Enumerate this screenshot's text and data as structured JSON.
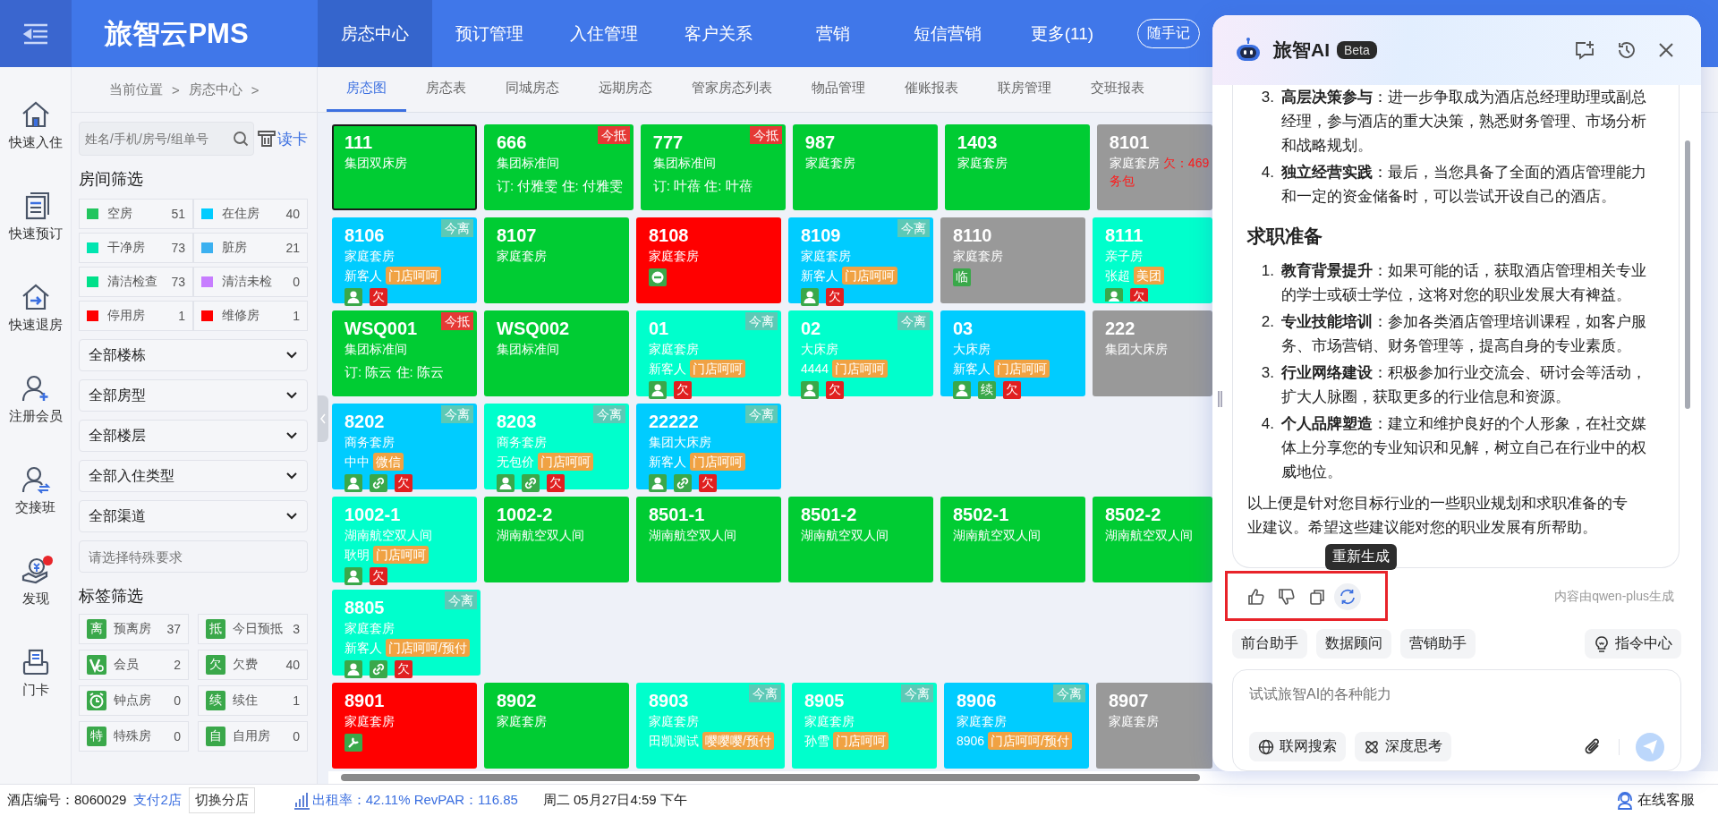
{
  "top_bar": {
    "brand": "旅智云PMS",
    "nav": [
      {
        "label": "房态中心",
        "selected": true
      },
      {
        "label": "预订管理",
        "selected": false
      },
      {
        "label": "入住管理",
        "selected": false
      },
      {
        "label": "客户关系",
        "selected": false
      },
      {
        "label": "营销",
        "selected": false
      },
      {
        "label": "短信营销",
        "selected": false
      },
      {
        "label": "更多(11)",
        "selected": false
      }
    ],
    "notes_button": "随手记"
  },
  "quick_actions": [
    {
      "kind": "home",
      "label": "快速入住",
      "badge": false
    },
    {
      "kind": "doc",
      "label": "快速预订",
      "badge": false
    },
    {
      "kind": "checkout",
      "label": "快速退房",
      "badge": false
    },
    {
      "kind": "user-add",
      "label": "注册会员",
      "badge": false
    },
    {
      "kind": "user-swap",
      "label": "交接班",
      "badge": false
    },
    {
      "kind": "money",
      "label": "发现",
      "badge": true
    },
    {
      "kind": "printer",
      "label": "门卡",
      "badge": false
    }
  ],
  "breadcrumb": {
    "items": [
      "当前位置",
      "房态中心"
    ],
    "separator": ">"
  },
  "search": {
    "placeholder": "姓名/手机/房号/组单号",
    "card_reader": "读卡"
  },
  "room_filter": {
    "title": "房间筛选",
    "items": [
      {
        "label": "空房",
        "count": "51",
        "color": "#22c55e"
      },
      {
        "label": "在住房",
        "count": "40",
        "color": "#00ccff"
      },
      {
        "label": "干净房",
        "count": "73",
        "color": "#00e5b0"
      },
      {
        "label": "脏房",
        "count": "21",
        "color": "#3bb0f0"
      },
      {
        "label": "清洁检查",
        "count": "73",
        "color": "#00e08a"
      },
      {
        "label": "清洁未检",
        "count": "0",
        "color": "#c77dff"
      },
      {
        "label": "停用房",
        "count": "1",
        "color": "#ff0000"
      },
      {
        "label": "维修房",
        "count": "1",
        "color": "#ff0000"
      }
    ]
  },
  "selects": [
    "全部楼栋",
    "全部房型",
    "全部楼层",
    "全部入住类型",
    "全部渠道"
  ],
  "special_request": {
    "placeholder": "请选择特殊要求"
  },
  "tag_filter": {
    "title": "标签筛选",
    "items": [
      {
        "kind": "char",
        "mark": "离",
        "label": "预离房",
        "count": "37"
      },
      {
        "kind": "char",
        "mark": "抵",
        "label": "今日预抵",
        "count": "3"
      },
      {
        "kind": "vip",
        "label": "会员",
        "count": "2"
      },
      {
        "kind": "char",
        "mark": "欠",
        "label": "欠费",
        "count": "40"
      },
      {
        "kind": "clock",
        "label": "钟点房",
        "count": "0"
      },
      {
        "kind": "char",
        "mark": "续",
        "label": "续住",
        "count": "1"
      },
      {
        "kind": "char",
        "mark": "特",
        "label": "特殊房",
        "count": "0"
      },
      {
        "kind": "char",
        "mark": "自",
        "label": "自用房",
        "count": "0"
      }
    ]
  },
  "tabs": [
    {
      "label": "房态图",
      "selected": true
    },
    {
      "label": "房态表",
      "selected": false
    },
    {
      "label": "同城房态",
      "selected": false
    },
    {
      "label": "远期房态",
      "selected": false
    },
    {
      "label": "管家房态列表",
      "selected": false
    },
    {
      "label": "物品管理",
      "selected": false
    },
    {
      "label": "催账报表",
      "selected": false
    },
    {
      "label": "联房管理",
      "selected": false
    },
    {
      "label": "交班报表",
      "selected": false
    }
  ],
  "room_rows": [
    {
      "rooms": [
        {
          "number": "111",
          "type": "集团双床房",
          "color": "#00cc33",
          "selected": true
        },
        {
          "number": "666",
          "type": "集团标准间",
          "color": "#00cc33",
          "selected": false,
          "tag": {
            "kind": "arrive",
            "text": "今抵"
          },
          "booking": "订: 付雅雯 住: 付雅雯"
        },
        {
          "number": "777",
          "type": "集团标准间",
          "color": "#00cc33",
          "selected": false,
          "tag": {
            "kind": "arrive",
            "text": "今抵"
          },
          "booking": "订: 叶蓓 住: 叶蓓"
        },
        {
          "number": "987",
          "type": "家庭套房",
          "color": "#00cc33",
          "selected": false
        },
        {
          "number": "1403",
          "type": "家庭套房",
          "color": "#00cc33",
          "selected": false
        },
        {
          "number": "8101",
          "type": "家庭套房",
          "color": "#999999",
          "selected": false,
          "debt": "欠：469",
          "debt_note": "务包"
        }
      ]
    },
    {
      "rooms": [
        {
          "number": "8106",
          "type": "家庭套房",
          "color": "#00ccff",
          "selected": false,
          "tag": {
            "kind": "leave",
            "text": "今离"
          },
          "guest": "新客人",
          "channel": "门店呵呵",
          "icons": [
            {
              "kind": "person"
            },
            {
              "kind": "char",
              "text": "欠",
              "color": "#e02020"
            }
          ]
        },
        {
          "number": "8107",
          "type": "家庭套房",
          "color": "#00cc33",
          "selected": false
        },
        {
          "number": "8108",
          "type": "家庭套房",
          "color": "#ff0000",
          "selected": false,
          "icons": [
            {
              "kind": "minus"
            }
          ]
        },
        {
          "number": "8109",
          "type": "家庭套房",
          "color": "#00ccff",
          "selected": false,
          "tag": {
            "kind": "leave",
            "text": "今离"
          },
          "guest": "新客人",
          "channel": "门店呵呵",
          "icons": [
            {
              "kind": "person"
            },
            {
              "kind": "char",
              "text": "欠",
              "color": "#e02020"
            }
          ]
        },
        {
          "number": "8110",
          "type": "家庭套房",
          "color": "#999999",
          "selected": false,
          "icons": [
            {
              "kind": "char",
              "text": "临",
              "color": "#3aa84a"
            }
          ]
        },
        {
          "number": "8111",
          "type": "亲子房",
          "color": "#00ffcc",
          "selected": false,
          "guest": "张超",
          "channel": "美团",
          "icons": [
            {
              "kind": "person"
            },
            {
              "kind": "char",
              "text": "欠",
              "color": "#e02020"
            }
          ]
        }
      ]
    },
    {
      "rooms": [
        {
          "number": "WSQ001",
          "type": "集团标准间",
          "color": "#00cc33",
          "selected": false,
          "tag": {
            "kind": "arrive",
            "text": "今抵"
          },
          "booking": "订: 陈云 住: 陈云"
        },
        {
          "number": "WSQ002",
          "type": "集团标准间",
          "color": "#00cc33",
          "selected": false
        },
        {
          "number": "01",
          "type": "家庭套房",
          "color": "#00ffcc",
          "selected": false,
          "tag": {
            "kind": "leave",
            "text": "今离"
          },
          "guest": "新客人",
          "channel": "门店呵呵",
          "icons": [
            {
              "kind": "person"
            },
            {
              "kind": "char",
              "text": "欠",
              "color": "#e02020"
            }
          ]
        },
        {
          "number": "02",
          "type": "大床房",
          "color": "#00ffcc",
          "selected": false,
          "tag": {
            "kind": "leave",
            "text": "今离"
          },
          "guest": "4444",
          "channel": "门店呵呵",
          "icons": [
            {
              "kind": "person"
            },
            {
              "kind": "char",
              "text": "欠",
              "color": "#e02020"
            }
          ]
        },
        {
          "number": "03",
          "type": "大床房",
          "color": "#00ccff",
          "selected": false,
          "guest": "新客人",
          "channel": "门店呵呵",
          "icons": [
            {
              "kind": "person"
            },
            {
              "kind": "char",
              "text": "续",
              "color": "#3aa84a"
            },
            {
              "kind": "char",
              "text": "欠",
              "color": "#e02020"
            }
          ]
        },
        {
          "number": "222",
          "type": "集团大床房",
          "color": "#999999",
          "selected": false
        }
      ]
    },
    {
      "rooms": [
        {
          "number": "8202",
          "type": "商务套房",
          "color": "#00ccff",
          "selected": false,
          "tag": {
            "kind": "leave",
            "text": "今离"
          },
          "guest": "中中",
          "channel": "微信",
          "icons": [
            {
              "kind": "person"
            },
            {
              "kind": "link"
            },
            {
              "kind": "char",
              "text": "欠",
              "color": "#e02020"
            }
          ]
        },
        {
          "number": "8203",
          "type": "商务套房",
          "color": "#00ffcc",
          "selected": false,
          "tag": {
            "kind": "leave",
            "text": "今离"
          },
          "guest": "无包价",
          "channel": "门店呵呵",
          "icons": [
            {
              "kind": "person"
            },
            {
              "kind": "link"
            },
            {
              "kind": "char",
              "text": "欠",
              "color": "#e02020"
            }
          ]
        },
        {
          "number": "22222",
          "type": "集团大床房",
          "color": "#00ccff",
          "selected": false,
          "tag": {
            "kind": "leave",
            "text": "今离"
          },
          "guest": "新客人",
          "channel": "门店呵呵",
          "icons": [
            {
              "kind": "person"
            },
            {
              "kind": "link"
            },
            {
              "kind": "char",
              "text": "欠",
              "color": "#e02020"
            }
          ]
        }
      ]
    },
    {
      "rooms": [
        {
          "number": "1002-1",
          "type": "湖南航空双人间",
          "color": "#00ffcc",
          "selected": false,
          "guest": "耿明",
          "channel": "门店呵呵",
          "icons": [
            {
              "kind": "person"
            },
            {
              "kind": "char",
              "text": "欠",
              "color": "#e02020"
            }
          ]
        },
        {
          "number": "1002-2",
          "type": "湖南航空双人间",
          "color": "#00cc33",
          "selected": false
        },
        {
          "number": "8501-1",
          "type": "湖南航空双人间",
          "color": "#00cc33",
          "selected": false
        },
        {
          "number": "8501-2",
          "type": "湖南航空双人间",
          "color": "#00cc33",
          "selected": false
        },
        {
          "number": "8502-1",
          "type": "湖南航空双人间",
          "color": "#00cc33",
          "selected": false
        },
        {
          "number": "8502-2",
          "type": "湖南航空双人间",
          "color": "#00cc33",
          "selected": false
        }
      ]
    },
    {
      "rooms": [
        {
          "number": "8805",
          "type": "家庭套房",
          "color": "#00ffcc",
          "selected": false,
          "tag": {
            "kind": "leave",
            "text": "今离"
          },
          "guest": "新客人",
          "channel": "门店呵呵/预付",
          "icons": [
            {
              "kind": "person"
            },
            {
              "kind": "link"
            },
            {
              "kind": "char",
              "text": "欠",
              "color": "#e02020"
            }
          ]
        }
      ]
    },
    {
      "rooms": [
        {
          "number": "8901",
          "type": "家庭套房",
          "color": "#ff0000",
          "selected": false,
          "icons": [
            {
              "kind": "wrench"
            }
          ]
        },
        {
          "number": "8902",
          "type": "家庭套房",
          "color": "#00cc33",
          "selected": false
        },
        {
          "number": "8903",
          "type": "家庭套房",
          "color": "#00ffcc",
          "selected": false,
          "tag": {
            "kind": "leave",
            "text": "今离"
          },
          "guest": "田凯测试",
          "channel": "嘤嘤嘤/预付"
        },
        {
          "number": "8905",
          "type": "家庭套房",
          "color": "#00ffcc",
          "selected": false,
          "tag": {
            "kind": "leave",
            "text": "今离"
          },
          "guest": "孙雪",
          "channel": "门店呵呵"
        },
        {
          "number": "8906",
          "type": "家庭套房",
          "color": "#00ccff",
          "selected": false,
          "tag": {
            "kind": "leave",
            "text": "今离"
          },
          "guest": "8906",
          "channel": "门店呵呵/预付"
        },
        {
          "number": "8907",
          "type": "家庭套房",
          "color": "#999999",
          "selected": false
        }
      ]
    }
  ],
  "status_bar": {
    "hotel": "酒店编号：8060029",
    "branch_link": "支付2店",
    "switch_button": "切换分店",
    "occupancy": "出租率：42.11% RevPAR：116.85",
    "datetime": "周二 05月27日4:59 下午",
    "support": "在线客服"
  },
  "ai_panel": {
    "title": "旅智AI",
    "badge": "Beta",
    "blocks": [
      {
        "kind": "list",
        "items": [
          {
            "number": "3.",
            "text": "**高层决策参与**：进一步争取成为酒店总经理助理或副总经理，参与酒店的重大决策，熟悉财务管理、市场分析和战略规划。"
          },
          {
            "number": "4.",
            "text": "**独立经营实践**：最后，当您具备了全面的酒店管理能力和一定的资金储备时，可以尝试开设自己的酒店。"
          }
        ]
      },
      {
        "kind": "heading",
        "text": "求职准备"
      },
      {
        "kind": "list",
        "items": [
          {
            "number": "1.",
            "text": "**教育背景提升**：如果可能的话，获取酒店管理相关专业的学士或硕士学位，这将对您的职业发展大有裨益。"
          },
          {
            "number": "2.",
            "text": "**专业技能培训**：参加各类酒店管理培训课程，如客户服务、市场营销、财务管理等，提高自身的专业素质。"
          },
          {
            "number": "3.",
            "text": "**行业网络建设**：积极参加行业交流会、研讨会等活动，扩大人脉圈，获取更多的行业信息和资源。"
          },
          {
            "number": "4.",
            "text": "**个人品牌塑造**：建立和维护良好的个人形象，在社交媒体上分享您的专业知识和见解，树立自己在行业中的权威地位。"
          }
        ]
      },
      {
        "kind": "paragraph",
        "text": "以上便是针对您目标行业的一些职业规划和求职准备的专业建议。希望这些建议能对您的职业发展有所帮助。"
      }
    ],
    "actions": [
      {
        "kind": "like",
        "active": false
      },
      {
        "kind": "dislike",
        "active": false
      },
      {
        "kind": "copy",
        "active": false
      },
      {
        "kind": "regenerate",
        "active": true
      }
    ],
    "highlight": true,
    "tooltip": "重新生成",
    "credit": "内容由qwen-plus生成",
    "chips": [
      "前台助手",
      "数据顾问",
      "营销助手"
    ],
    "command_center": "指令中心",
    "input": {
      "placeholder": "试试旅智AI的各种能力"
    },
    "tools": [
      {
        "kind": "globe",
        "label": "联网搜索"
      },
      {
        "kind": "think",
        "label": "深度思考"
      }
    ]
  }
}
